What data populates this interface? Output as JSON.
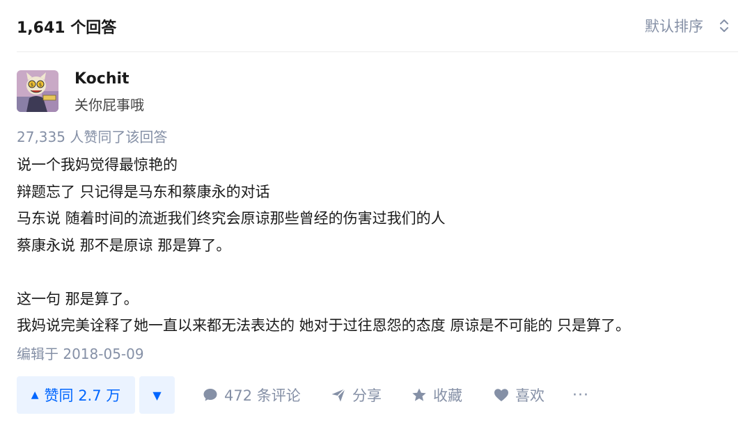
{
  "header": {
    "answer_count": "1,641 个回答",
    "sort_label": "默认排序"
  },
  "author": {
    "name": "Kochit",
    "headline": "关你屁事哦",
    "avatar_icon": "cartoon-cat-avatar"
  },
  "vote_summary": "27,335 人赞同了该回答",
  "content": {
    "lines": [
      "说一个我妈觉得最惊艳的",
      "辩题忘了 只记得是马东和蔡康永的对话",
      "马东说 随着时间的流逝我们终究会原谅那些曾经的伤害过我们的人",
      "蔡康永说 那不是原谅 那是算了。",
      "",
      "这一句 那是算了。",
      "我妈说完美诠释了她一直以来都无法表达的 她对于过往恩怨的态度 原谅是不可能的 只是算了。"
    ]
  },
  "edit_time": "编辑于 2018-05-09",
  "actions": {
    "upvote_label": "赞同 2.7 万",
    "comment_label": "472 条评论",
    "share_label": "分享",
    "favorite_label": "收藏",
    "like_label": "喜欢",
    "more_label": "···"
  },
  "colors": {
    "accent": "#0066ff",
    "accent_bg": "#ebf3ff",
    "muted": "#8590a6"
  }
}
